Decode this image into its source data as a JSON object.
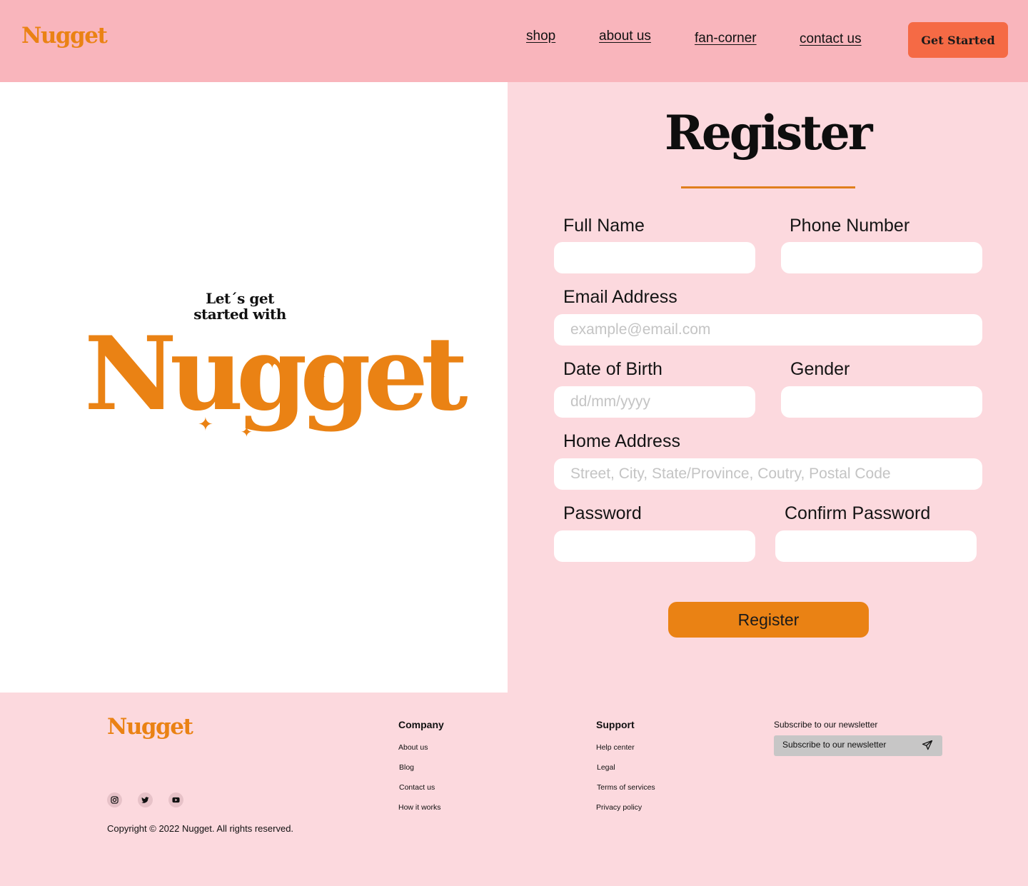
{
  "header": {
    "logo": "Nugget",
    "nav": [
      {
        "label": "shop"
      },
      {
        "label": "about us"
      },
      {
        "label": "fan-corner"
      },
      {
        "label": "contact us"
      }
    ],
    "cta_label": "Get Started"
  },
  "hero": {
    "tagline_line1": "Let´s get",
    "tagline_line2": "started with",
    "logo": "Nugget"
  },
  "form": {
    "title": "Register",
    "full_name_label": "Full Name",
    "phone_label": "Phone Number",
    "email_label": "Email Address",
    "email_placeholder": "example@email.com",
    "dob_label": "Date of Birth",
    "dob_placeholder": "dd/mm/yyyy",
    "gender_label": "Gender",
    "address_label": "Home Address",
    "address_placeholder": "Street, City, State/Province, Coutry, Postal Code",
    "password_label": "Password",
    "confirm_label": "Confirm Password",
    "submit_label": "Register"
  },
  "footer": {
    "logo": "Nugget",
    "copyright": "Copyright © 2022 Nugget. All rights reserved.",
    "company_title": "Company",
    "company_links": [
      "About us",
      "Blog",
      "Contact us",
      "How it works"
    ],
    "support_title": "Support",
    "support_links": [
      "Help center",
      "Legal",
      "Terms of services",
      "Privacy policy"
    ],
    "newsletter_title": "Subscribe to our newsletter",
    "newsletter_placeholder": "Subscribe to our newsletter",
    "socials": [
      "instagram-icon",
      "twitter-icon",
      "youtube-icon"
    ]
  },
  "colors": {
    "header_bg": "#f9b5bc",
    "page_bg": "#fcd9de",
    "brand_orange": "#ea8214",
    "cta_coral": "#f56a45"
  }
}
